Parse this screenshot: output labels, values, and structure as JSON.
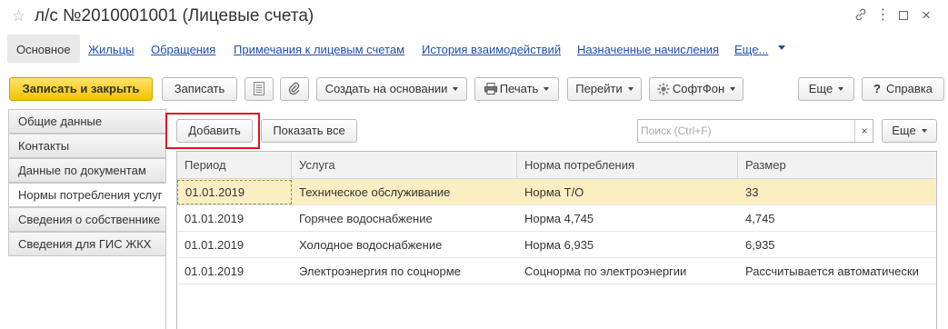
{
  "window": {
    "title": "л/с №2010001001 (Лицевые счета)"
  },
  "nav": {
    "tabs": [
      {
        "label": "Основное"
      },
      {
        "label": "Жильцы"
      },
      {
        "label": "Обращения"
      },
      {
        "label": "Примечания к лицевым счетам"
      },
      {
        "label": "История взаимодействий"
      },
      {
        "label": "Назначенные начисления"
      },
      {
        "label": "Еще..."
      }
    ]
  },
  "toolbar": {
    "save_close_label": "Записать и закрыть",
    "save_label": "Записать",
    "create_based_label": "Создать на основании",
    "print_label": "Печать",
    "goto_label": "Перейти",
    "softphone_label": "СофтФон",
    "more_label": "Еще",
    "help_label": "Справка"
  },
  "sidebar": {
    "items": [
      {
        "label": "Общие данные"
      },
      {
        "label": "Контакты"
      },
      {
        "label": "Данные по документам"
      },
      {
        "label": "Нормы потребления услуг"
      },
      {
        "label": "Сведения о собственнике"
      },
      {
        "label": "Сведения для ГИС ЖКХ"
      }
    ]
  },
  "subtoolbar": {
    "add_label": "Добавить",
    "show_all_label": "Показать все",
    "search_placeholder": "Поиск (Ctrl+F)",
    "clear_label": "×",
    "more_label": "Еще"
  },
  "table": {
    "columns": [
      "Период",
      "Услуга",
      "Норма потребления",
      "Размер"
    ],
    "rows": [
      {
        "period": "01.01.2019",
        "service": "Техническое обслуживание",
        "norm": "Норма Т/О",
        "size": "33"
      },
      {
        "period": "01.01.2019",
        "service": "Горячее водоснабжение",
        "norm": "Норма 4,745",
        "size": "4,745"
      },
      {
        "period": "01.01.2019",
        "service": "Холодное водоснабжение",
        "norm": "Норма 6,935",
        "size": "6,935"
      },
      {
        "period": "01.01.2019",
        "service": "Электроэнергия по соцнорме",
        "norm": "Соцнорма по электроэнергии",
        "size": "Рассчитывается автоматически"
      }
    ]
  },
  "colors": {
    "primary_button": "#f3c300",
    "link": "#1f4fa8",
    "selected_row": "#fbeec2",
    "highlight_frame": "#e0141e"
  }
}
